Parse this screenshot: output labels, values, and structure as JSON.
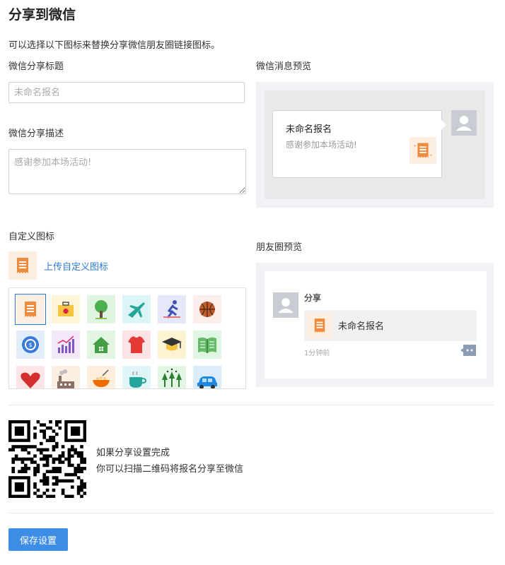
{
  "page": {
    "title": "分享到微信",
    "description": "可以选择以下图标来替换分享微信朋友圈链接图标。"
  },
  "form": {
    "share_title_label": "微信分享标题",
    "share_title_placeholder": "未命名报名",
    "share_desc_label": "微信分享描述",
    "share_desc_placeholder": "感谢参加本场活动!",
    "custom_icon_label": "自定义图标",
    "upload_link": "上传自定义图标"
  },
  "message_preview": {
    "label": "微信消息预览",
    "title": "未命名报名",
    "desc": "感谢参加本场活动!"
  },
  "moments_preview": {
    "label": "朋友圈预览",
    "user_name": "分享",
    "card_title": "未命名报名",
    "time": "1分钟前"
  },
  "icon_grid": {
    "icons": [
      {
        "name": "document",
        "bg": "#fdeee2",
        "selected": true
      },
      {
        "name": "toolbox",
        "bg": "#fdf5d6"
      },
      {
        "name": "tree",
        "bg": "#dff5e2"
      },
      {
        "name": "airplane",
        "bg": "#ddf4f7"
      },
      {
        "name": "runner",
        "bg": "#e4e8f8"
      },
      {
        "name": "basketball",
        "bg": "#fceeea"
      },
      {
        "name": "coin",
        "bg": "#e2eef9"
      },
      {
        "name": "bar-chart",
        "bg": "#f3e8fa"
      },
      {
        "name": "house",
        "bg": "#e2f5e3"
      },
      {
        "name": "shirt",
        "bg": "#fde3e6"
      },
      {
        "name": "graduation-cap",
        "bg": "#fdf3d2"
      },
      {
        "name": "book",
        "bg": "#e1f5e3"
      },
      {
        "name": "heart",
        "bg": "#fde4e6"
      },
      {
        "name": "factory",
        "bg": "#fdeee2"
      },
      {
        "name": "bowl",
        "bg": "#fdeede"
      },
      {
        "name": "coffee-cup",
        "bg": "#dff5f6"
      },
      {
        "name": "forest",
        "bg": "#e1f7e4"
      },
      {
        "name": "car",
        "bg": "#dcedfa"
      }
    ]
  },
  "qr_section": {
    "line1": "如果分享设置完成",
    "line2": "你可以扫描二维码将报名分享至微信"
  },
  "actions": {
    "save_label": "保存设置"
  },
  "colors": {
    "accent": "#3d8ce6",
    "link": "#2e7ad1",
    "doc_icon": "#f08a3c"
  }
}
